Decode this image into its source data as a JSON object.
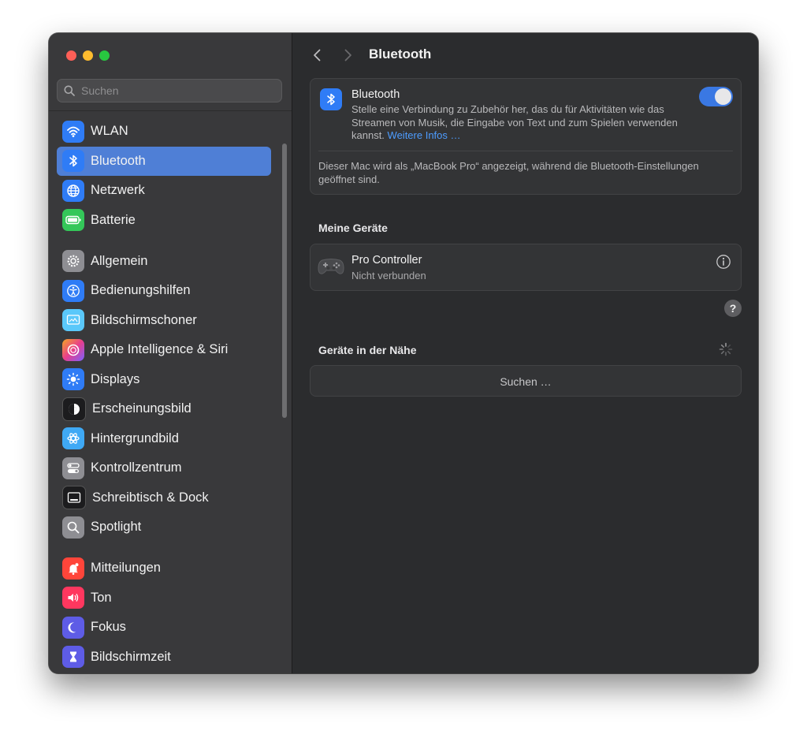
{
  "sidebar": {
    "search_placeholder": "Suchen",
    "items": [
      {
        "label": "WLAN",
        "icon": "wifi-icon",
        "color": "#2f7cf6"
      },
      {
        "label": "Bluetooth",
        "icon": "bluetooth-icon",
        "color": "#2f7cf6",
        "active": true
      },
      {
        "label": "Netzwerk",
        "icon": "globe-icon",
        "color": "#2f7cf6"
      },
      {
        "label": "Batterie",
        "icon": "battery-icon",
        "color": "#34c759"
      },
      {
        "label": "Allgemein",
        "icon": "gear-icon",
        "color": "#8e8e93"
      },
      {
        "label": "Bedienungshilfen",
        "icon": "accessibility-icon",
        "color": "#2f7cf6"
      },
      {
        "label": "Bildschirmschoner",
        "icon": "screensaver-icon",
        "color": "#5ac8fa"
      },
      {
        "label": "Apple Intelligence & Siri",
        "icon": "siri-icon",
        "color": "#d94fc4"
      },
      {
        "label": "Displays",
        "icon": "sun-icon",
        "color": "#2f7cf6"
      },
      {
        "label": "Erscheinungsbild",
        "icon": "appearance-icon",
        "color": "#1c1c1e"
      },
      {
        "label": "Hintergrundbild",
        "icon": "flower-icon",
        "color": "#3fa9f5"
      },
      {
        "label": "Kontrollzentrum",
        "icon": "toggles-icon",
        "color": "#8e8e93"
      },
      {
        "label": "Schreibtisch & Dock",
        "icon": "dock-icon",
        "color": "#1c1c1e"
      },
      {
        "label": "Spotlight",
        "icon": "magnifier-icon",
        "color": "#8e8e93"
      },
      {
        "label": "Mitteilungen",
        "icon": "bell-icon",
        "color": "#ff453a"
      },
      {
        "label": "Ton",
        "icon": "speaker-icon",
        "color": "#ff375f"
      },
      {
        "label": "Fokus",
        "icon": "moon-icon",
        "color": "#5e5ce6"
      },
      {
        "label": "Bildschirmzeit",
        "icon": "hourglass-icon",
        "color": "#5e5ce6"
      }
    ]
  },
  "main": {
    "title": "Bluetooth",
    "bluetooth": {
      "title": "Bluetooth",
      "description": "Stelle eine Verbindung zu Zubehör her, das du für Aktivitäten wie das Streamen von Musik, die Eingabe von Text und zum Spielen verwenden kannst.",
      "link": "Weitere Infos …",
      "enabled": true,
      "note": "Dieser Mac wird als „MacBook Pro“ angezeigt, während die Bluetooth-Einstellungen geöffnet sind."
    },
    "my_devices": {
      "title": "Meine Geräte",
      "devices": [
        {
          "name": "Pro Controller",
          "status": "Nicht verbunden",
          "icon": "gamepad-icon"
        }
      ]
    },
    "help_label": "?",
    "nearby": {
      "title": "Geräte in der Nähe",
      "searching": "Suchen …"
    },
    "accent": "#3a78e3",
    "link_color": "#4d9cff"
  }
}
